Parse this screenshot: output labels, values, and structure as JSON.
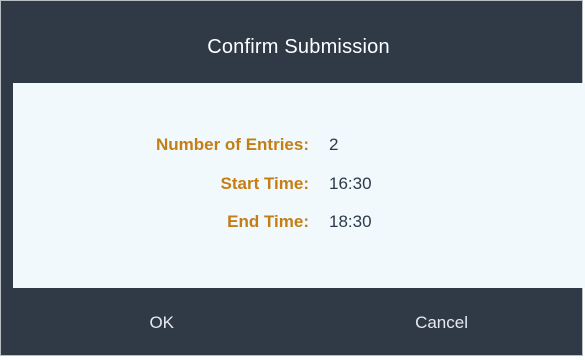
{
  "dialog": {
    "title": "Confirm Submission",
    "fields": [
      {
        "label": "Number of Entries:",
        "value": "2"
      },
      {
        "label": "Start Time:",
        "value": "16:30"
      },
      {
        "label": "End Time:",
        "value": "18:30"
      }
    ],
    "buttons": {
      "ok_label": "OK",
      "cancel_label": "Cancel"
    }
  },
  "colors": {
    "header_background": "#2f3a46",
    "body_background": "#f1f9fc",
    "label_color": "#c47e14",
    "value_color": "#2b3a4a",
    "title_color": "#ffffff"
  }
}
